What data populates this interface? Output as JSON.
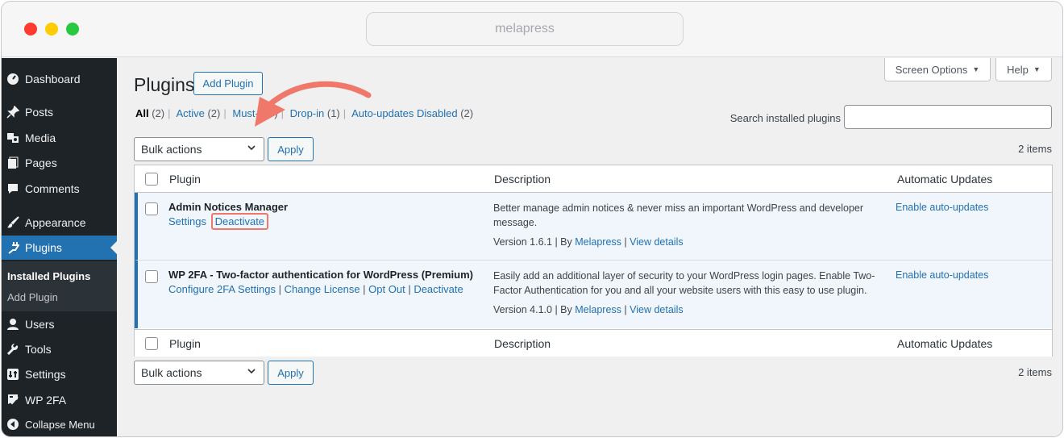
{
  "browser": {
    "url": "melapress"
  },
  "sidebar": {
    "items": [
      {
        "label": "Dashboard",
        "icon": "dashboard-icon"
      },
      {
        "label": "Posts",
        "icon": "pin-icon"
      },
      {
        "label": "Media",
        "icon": "media-icon"
      },
      {
        "label": "Pages",
        "icon": "pages-icon"
      },
      {
        "label": "Comments",
        "icon": "comment-icon"
      },
      {
        "label": "Appearance",
        "icon": "brush-icon"
      },
      {
        "label": "Plugins",
        "icon": "plugin-icon"
      },
      {
        "label": "Users",
        "icon": "user-icon"
      },
      {
        "label": "Tools",
        "icon": "wrench-icon"
      },
      {
        "label": "Settings",
        "icon": "settings-icon"
      },
      {
        "label": "WP 2FA",
        "icon": "wp2fa-icon"
      },
      {
        "label": "Collapse Menu",
        "icon": "collapse-icon"
      }
    ],
    "submenu": [
      "Installed Plugins",
      "Add Plugin"
    ]
  },
  "header": {
    "screen_options": "Screen Options",
    "help": "Help",
    "title": "Plugins",
    "add_plugin": "Add Plugin"
  },
  "filters": {
    "all": "All",
    "all_count": "(2)",
    "active": "Active",
    "active_count": "(2)",
    "mustuse": "Must-U",
    "mustuse_count": ")",
    "dropin": "Drop-in",
    "dropin_count": "(1)",
    "autodisabled": "Auto-updates Disabled",
    "autodisabled_count": "(2)"
  },
  "search": {
    "label": "Search installed plugins",
    "value": ""
  },
  "bulk": {
    "label": "Bulk actions",
    "apply": "Apply",
    "count": "2 items"
  },
  "table": {
    "col_plugin": "Plugin",
    "col_description": "Description",
    "col_updates": "Automatic Updates",
    "rows": [
      {
        "name": "Admin Notices Manager",
        "actions": [
          "Settings",
          "Deactivate"
        ],
        "description": "Better manage admin notices & never miss an important WordPress and developer message.",
        "version": "Version 1.6.1",
        "by": "By",
        "author": "Melapress",
        "details": "View details",
        "autoupdate": "Enable auto-updates"
      },
      {
        "name": "WP 2FA - Two-factor authentication for WordPress (Premium)",
        "actions": [
          "Configure 2FA Settings",
          "Change License",
          "Opt Out",
          "Deactivate"
        ],
        "description": "Easily add an additional layer of security to your WordPress login pages. Enable Two-Factor Authentication for you and all your website users with this easy to use plugin.",
        "version": "Version 4.1.0",
        "by": "By",
        "author": "Melapress",
        "details": "View details",
        "autoupdate": "Enable auto-updates"
      }
    ]
  },
  "colors": {
    "accent": "#2271b1",
    "sidebar": "#1d2327",
    "annotation": "#f0786a"
  }
}
